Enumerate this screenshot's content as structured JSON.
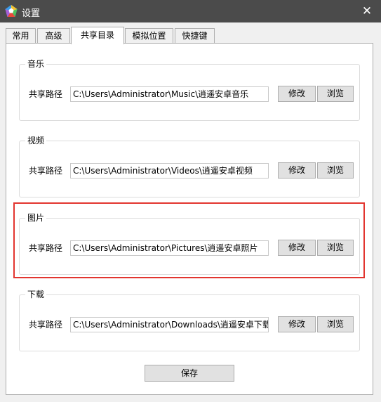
{
  "window": {
    "title": "设置",
    "close_label": "✕",
    "titlebar_color": "#4b4b4b"
  },
  "tabs": [
    {
      "label": "常用",
      "active": false
    },
    {
      "label": "高级",
      "active": false
    },
    {
      "label": "共享目录",
      "active": true
    },
    {
      "label": "模拟位置",
      "active": false
    },
    {
      "label": "快捷键",
      "active": false
    }
  ],
  "groups": [
    {
      "title": "音乐",
      "path_label": "共享路径",
      "path_value": "C:\\Users\\Administrator\\Music\\逍遥安卓音乐",
      "modify_label": "修改",
      "browse_label": "浏览"
    },
    {
      "title": "视频",
      "path_label": "共享路径",
      "path_value": "C:\\Users\\Administrator\\Videos\\逍遥安卓视频",
      "modify_label": "修改",
      "browse_label": "浏览"
    },
    {
      "title": "图片",
      "path_label": "共享路径",
      "path_value": "C:\\Users\\Administrator\\Pictures\\逍遥安卓照片",
      "modify_label": "修改",
      "browse_label": "浏览",
      "highlighted": true
    },
    {
      "title": "下载",
      "path_label": "共享路径",
      "path_value": "C:\\Users\\Administrator\\Downloads\\逍遥安卓下载",
      "modify_label": "修改",
      "browse_label": "浏览"
    }
  ],
  "save_label": "保存",
  "highlight_color": "#e2352f"
}
